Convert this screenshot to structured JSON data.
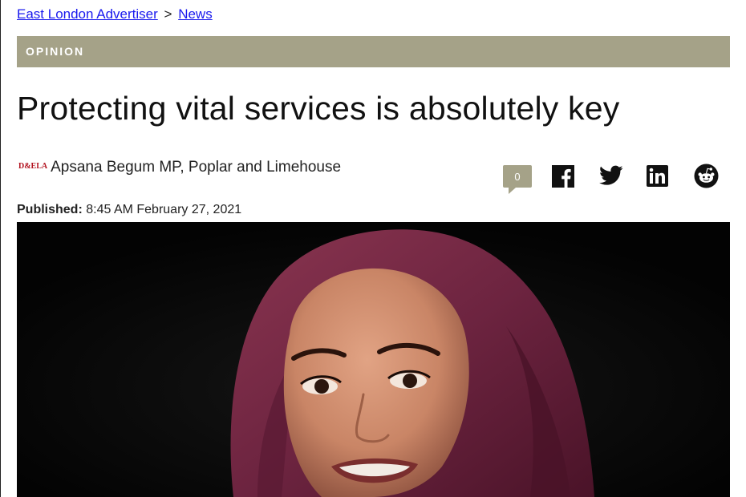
{
  "breadcrumb": {
    "home": "East London Advertiser",
    "separator": ">",
    "section": "News"
  },
  "category": {
    "label": "OPINION",
    "color": "#a5a288"
  },
  "article": {
    "headline": "Protecting vital services is absolutely key",
    "publication_logo": "D&ELA",
    "author": "Apsana Begum MP, Poplar and Limehouse",
    "published_label": "Published:",
    "published_value": "8:45 AM February 27, 2021"
  },
  "share": {
    "comment_count": "0",
    "icons": [
      "comment-icon",
      "facebook-icon",
      "twitter-icon",
      "linkedin-icon",
      "reddit-icon"
    ]
  },
  "hero_image": {
    "subject": "photo-of-woman-in-maroon-hijab",
    "background": "#050505"
  },
  "colors": {
    "link": "#1a1aee",
    "accent": "#a5a288",
    "logo_red": "#b2121f"
  }
}
